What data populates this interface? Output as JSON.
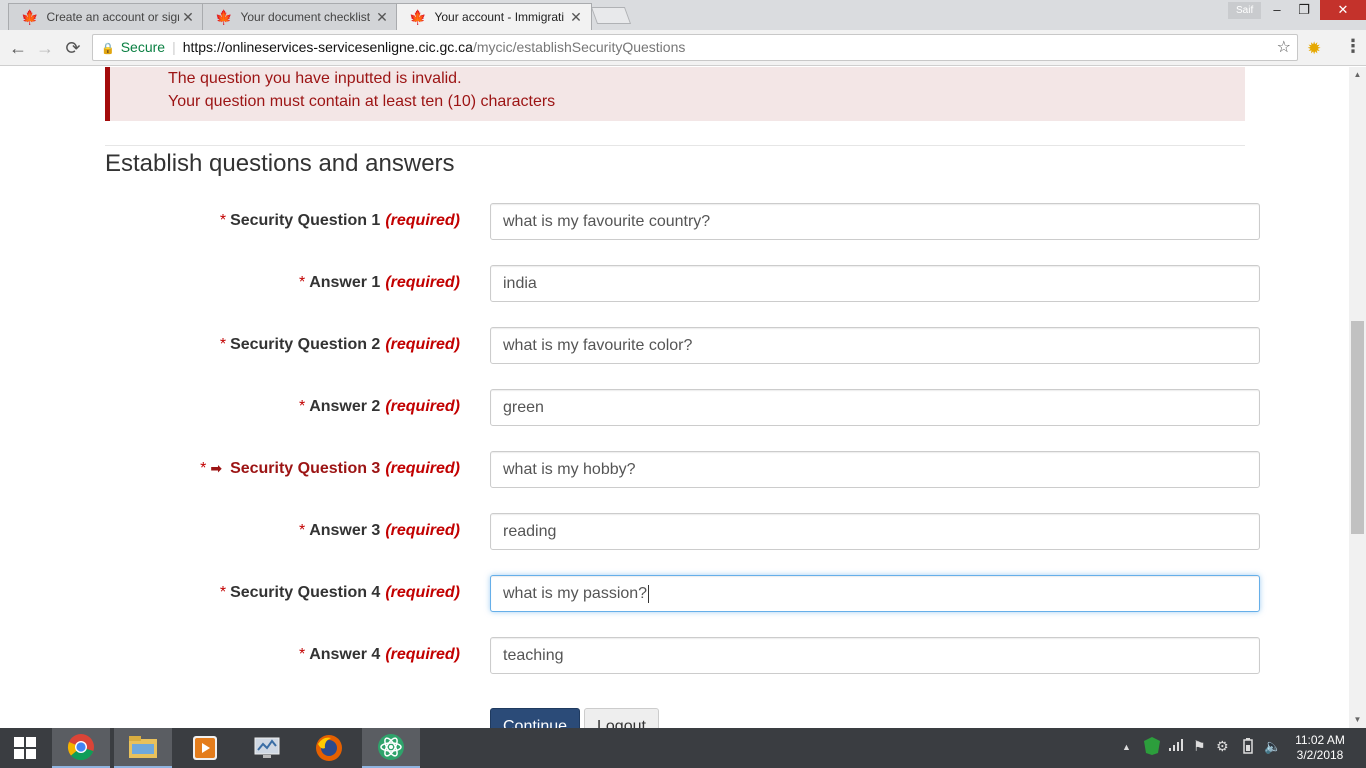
{
  "browser": {
    "tabs": [
      {
        "label": "Create an account or sign",
        "active": false
      },
      {
        "label": "Your document checklist",
        "active": false
      },
      {
        "label": "Your account - Immigrati",
        "active": true
      }
    ],
    "profile_name": "Saif",
    "url": {
      "secure_label": "Secure",
      "host": "https://onlineservices-servicesenligne.cic.gc.ca",
      "path": "/mycic/establishSecurityQuestions"
    }
  },
  "page": {
    "error_lines": [
      "The question you have inputted is invalid.",
      "Your question must contain at least ten (10) characters"
    ],
    "heading": "Establish questions and answers",
    "required_text": "(required)",
    "fields": [
      {
        "label": "Security Question 1",
        "value": "what is my favourite country?",
        "error": false
      },
      {
        "label": "Answer 1",
        "value": "india",
        "error": false
      },
      {
        "label": "Security Question 2",
        "value": "what is my favourite color?",
        "error": false
      },
      {
        "label": "Answer 2",
        "value": "green",
        "error": false
      },
      {
        "label": "Security Question 3",
        "value": "what is my hobby?",
        "error": true
      },
      {
        "label": "Answer 3",
        "value": "reading",
        "error": false
      },
      {
        "label": "Security Question 4",
        "value": "what is my passion?",
        "error": false,
        "focused": true
      },
      {
        "label": "Answer 4",
        "value": "teaching",
        "error": false
      }
    ],
    "buttons": {
      "continue": "Continue",
      "logout": "Logout"
    }
  },
  "taskbar": {
    "time": "11:02 AM",
    "date": "3/2/2018"
  },
  "colors": {
    "error_red": "#9c1414",
    "required_red": "#c20000",
    "primary_button": "#2b4b78",
    "focus_border": "#66afe9"
  }
}
